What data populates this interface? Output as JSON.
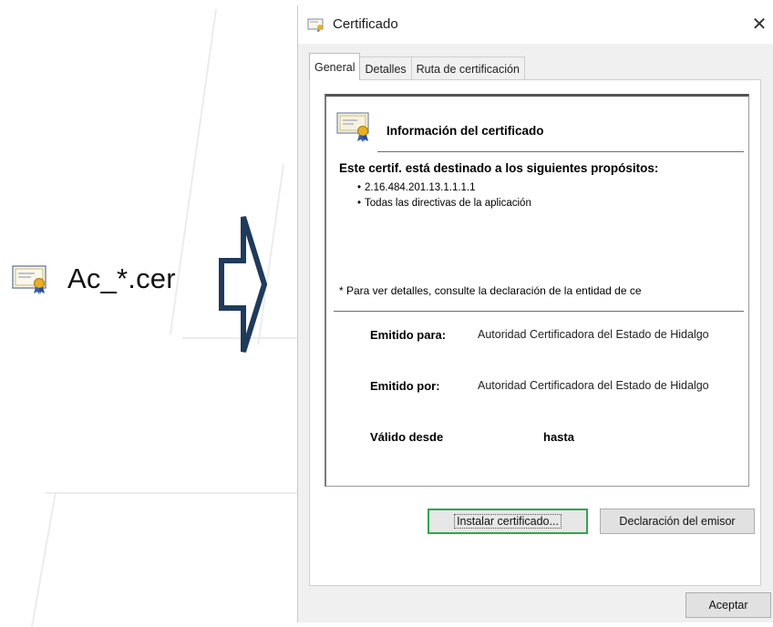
{
  "file": {
    "label": "Ac_*.cer",
    "icon": "certificate-icon"
  },
  "arrow": {
    "icon": "right-arrow-icon"
  },
  "dialog": {
    "title": "Certificado",
    "title_icon": "certificate-icon",
    "close_label": "✕",
    "tabs": [
      {
        "label": "General",
        "active": true
      },
      {
        "label": "Detalles",
        "active": false
      },
      {
        "label": "Ruta de certificación",
        "active": false
      }
    ],
    "info_title": "Información del certificado",
    "purpose_heading": "Este certif. está destinado a los siguientes propósitos:",
    "purposes": [
      "2.16.484.201.13.1.1.1.1",
      "Todas las directivas de la aplicación"
    ],
    "note": "* Para ver detalles, consulte la declaración de la entidad de ce",
    "issued_to_label": "Emitido para:",
    "issued_to_value": "Autoridad Certificadora del Estado de Hidalgo",
    "issued_by_label": "Emitido por:",
    "issued_by_value": "Autoridad Certificadora del Estado de Hidalgo",
    "valid_from_label": "Válido desde",
    "valid_to_label": "hasta",
    "install_button": "Instalar certificado...",
    "statement_button": "Declaración del emisor",
    "ok_button": "Aceptar"
  },
  "colors": {
    "primary_focus": "#2aa94a",
    "arrow": "#1f3b5c"
  }
}
